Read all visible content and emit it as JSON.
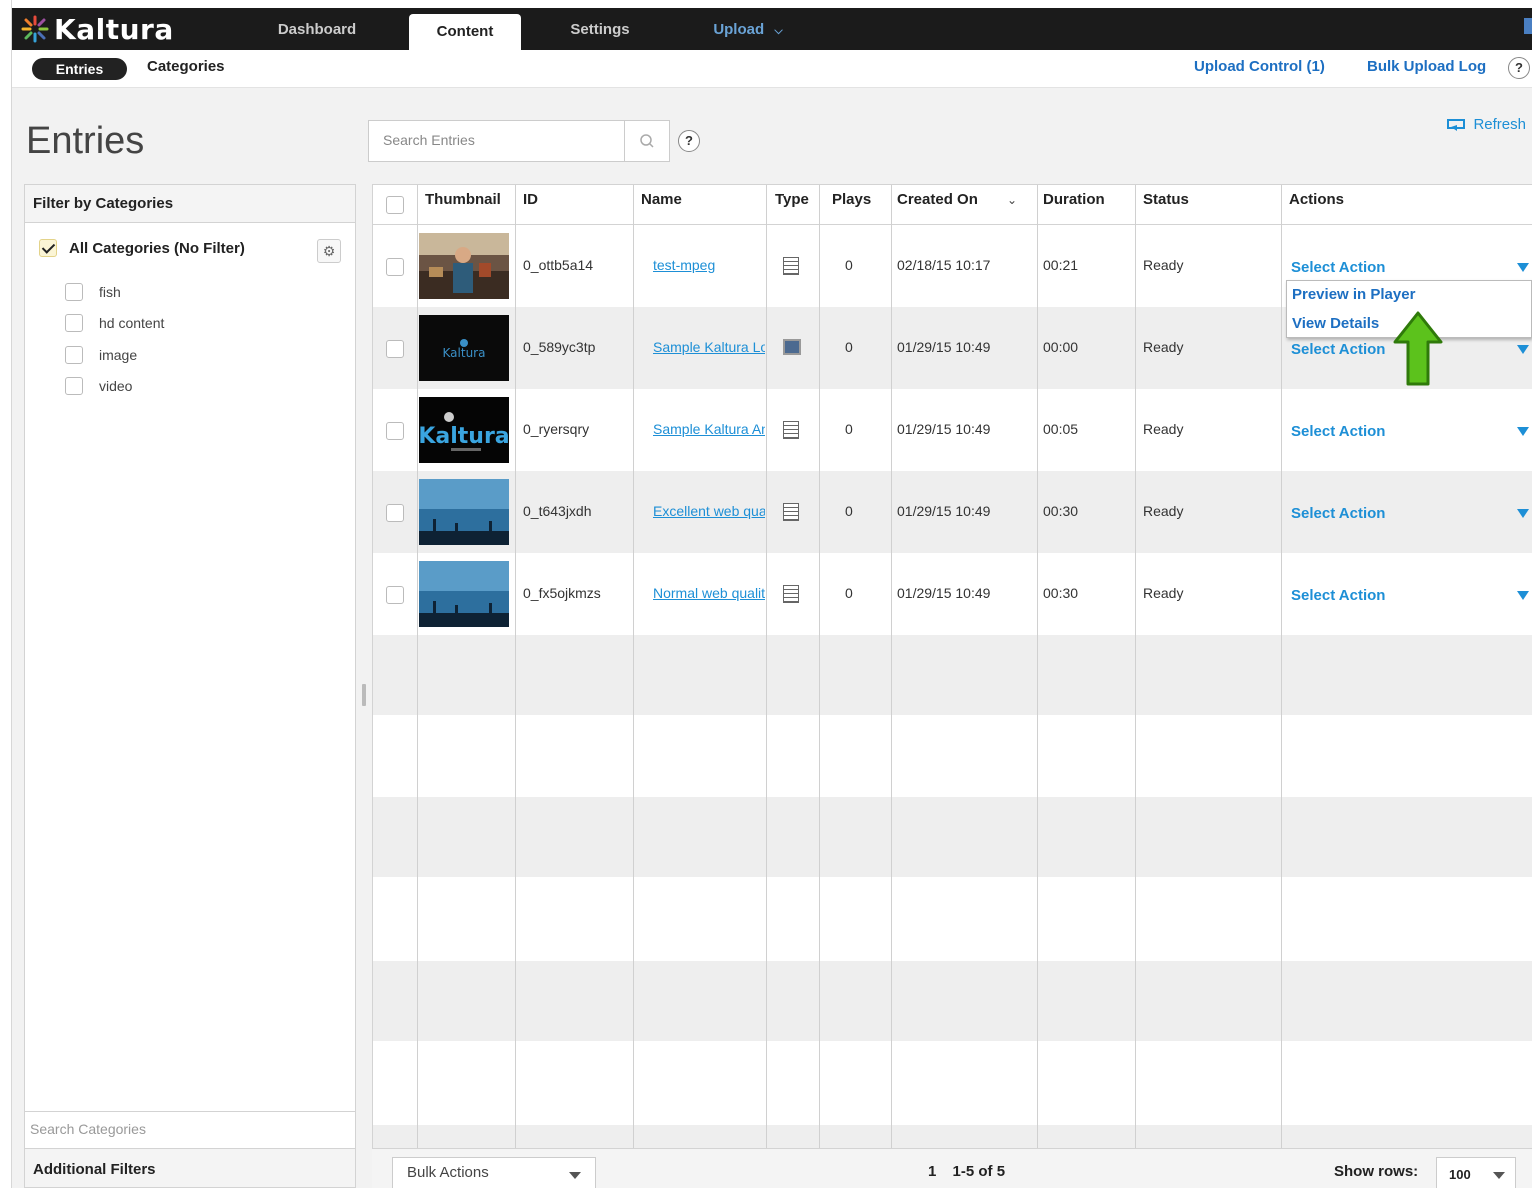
{
  "nav": {
    "logo_text": "Kaltura",
    "tabs": [
      {
        "label": "Dashboard"
      },
      {
        "label": "Content"
      },
      {
        "label": "Settings"
      },
      {
        "label": "Upload"
      }
    ],
    "active_tab": "Content"
  },
  "subnav": {
    "entries_label": "Entries",
    "categories_label": "Categories",
    "upload_control": "Upload Control (1)",
    "bulk_upload_log": "Bulk Upload Log",
    "help": "?"
  },
  "page": {
    "title": "Entries",
    "search_placeholder": "Search Entries",
    "help": "?",
    "refresh": "Refresh"
  },
  "sidebar": {
    "header": "Filter by Categories",
    "all_categories": "All Categories (No Filter)",
    "items": [
      {
        "label": "fish"
      },
      {
        "label": "hd content"
      },
      {
        "label": "image"
      },
      {
        "label": "video"
      }
    ],
    "search_placeholder": "Search Categories",
    "additional_filters": "Additional Filters"
  },
  "table": {
    "columns": [
      "Thumbnail",
      "ID",
      "Name",
      "Type",
      "Plays",
      "Created On",
      "Duration",
      "Status",
      "Actions"
    ],
    "rows": [
      {
        "id": "0_ottb5a14",
        "name": "test-mpeg",
        "type": "video",
        "plays": "0",
        "created": "02/18/15 10:17",
        "duration": "00:21",
        "status": "Ready",
        "action": "Select Action",
        "thumb": "person"
      },
      {
        "id": "0_589yc3tp",
        "name": "Sample Kaltura Logo",
        "type": "image",
        "plays": "0",
        "created": "01/29/15 10:49",
        "duration": "00:00",
        "status": "Ready",
        "action": "Select Action",
        "thumb": "logo-small"
      },
      {
        "id": "0_ryersqry",
        "name": "Sample Kaltura Animated Logo",
        "type": "video",
        "plays": "0",
        "created": "01/29/15 10:49",
        "duration": "00:05",
        "status": "Ready",
        "action": "Select Action",
        "thumb": "logo-large"
      },
      {
        "id": "0_t643jxdh",
        "name": "Excellent web quality",
        "type": "video",
        "plays": "0",
        "created": "01/29/15 10:49",
        "duration": "00:30",
        "status": "Ready",
        "action": "Select Action",
        "thumb": "ocean"
      },
      {
        "id": "0_fx5ojkmzs",
        "name": "Normal web quality",
        "type": "video",
        "plays": "0",
        "created": "01/29/15 10:49",
        "duration": "00:30",
        "status": "Ready",
        "action": "Select Action",
        "thumb": "ocean"
      }
    ]
  },
  "dropdown": {
    "items": [
      "Preview in Player",
      "View Details"
    ]
  },
  "footer": {
    "bulk_actions": "Bulk Actions",
    "page": "1",
    "range": "1-5 of 5",
    "show_rows_label": "Show rows:",
    "rows_value": "100"
  },
  "colors": {
    "link": "#1d8fd6",
    "nav_bg": "#1b1b1b",
    "arrow": "#5cc21c"
  }
}
